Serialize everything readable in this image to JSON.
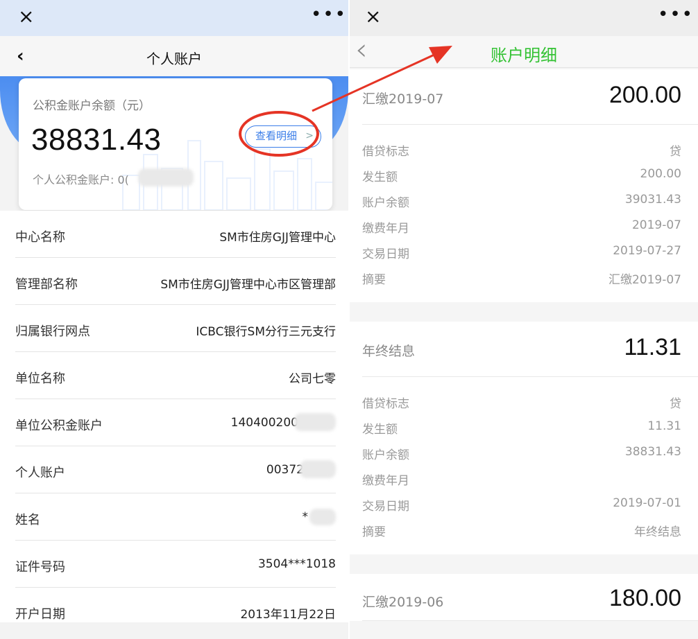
{
  "left": {
    "close_icon": "×",
    "more_icon": "•••",
    "back_icon": "‹",
    "title": "个人账户",
    "card": {
      "label": "公积金账户余额（元）",
      "balance": "38831.43",
      "account_label": "个人公积金账户: 0(",
      "detail_button": "查看明细",
      "detail_chevron": ">"
    },
    "info": [
      {
        "label": "中心名称",
        "value": "SM市住房GJJ管理中心"
      },
      {
        "label": "管理部名称",
        "value": "SM市住房GJJ管理中心市区管理部"
      },
      {
        "label": "归属银行网点",
        "value": "ICBC银行SM分行三元支行"
      },
      {
        "label": "单位名称",
        "value": "公司七零"
      },
      {
        "label": "单位公积金账户",
        "value": "140400200"
      },
      {
        "label": "个人账户",
        "value": "00372"
      },
      {
        "label": "姓名",
        "value": "*"
      },
      {
        "label": "证件号码",
        "value": "3504***1018"
      },
      {
        "label": "开户日期",
        "value": "2013年11月22日"
      }
    ]
  },
  "right": {
    "close_icon": "×",
    "more_icon": "•••",
    "back_icon": "‹",
    "title": "账户明细",
    "transactions": [
      {
        "title": "汇缴2019-07",
        "amount": "200.00",
        "rows": [
          {
            "k": "借贷标志",
            "v": "贷"
          },
          {
            "k": "发生额",
            "v": "200.00"
          },
          {
            "k": "账户余额",
            "v": "39031.43"
          },
          {
            "k": "缴费年月",
            "v": "2019-07"
          },
          {
            "k": "交易日期",
            "v": "2019-07-27"
          },
          {
            "k": "摘要",
            "v": "汇缴2019-07"
          }
        ]
      },
      {
        "title": "年终结息",
        "amount": "11.31",
        "rows": [
          {
            "k": "借贷标志",
            "v": "贷"
          },
          {
            "k": "发生额",
            "v": "11.31"
          },
          {
            "k": "账户余额",
            "v": "38831.43"
          },
          {
            "k": "缴费年月",
            "v": ""
          },
          {
            "k": "交易日期",
            "v": "2019-07-01"
          },
          {
            "k": "摘要",
            "v": "年终结息"
          }
        ]
      },
      {
        "title": "汇缴2019-06",
        "amount": "180.00"
      }
    ]
  },
  "colors": {
    "accent_blue": "#3a7de8",
    "annotation_red": "#e53425",
    "title_green": "#34c234"
  }
}
